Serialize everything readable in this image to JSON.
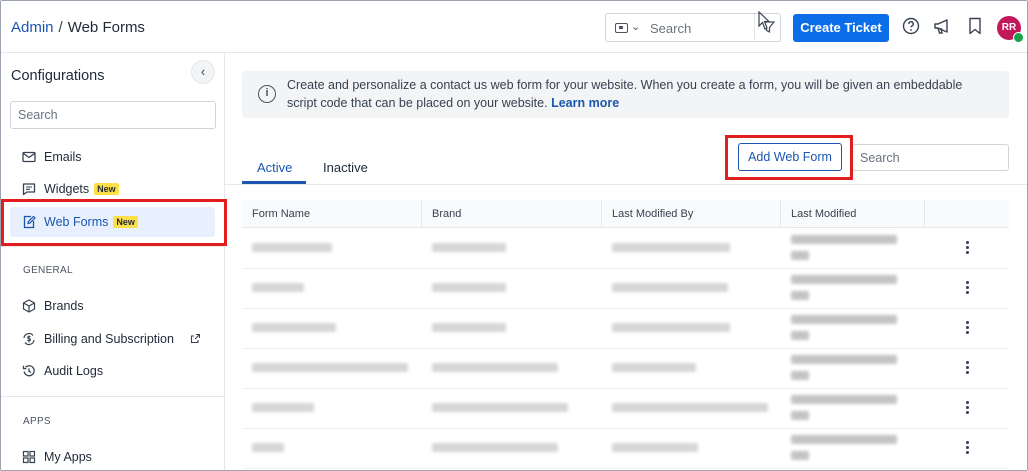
{
  "breadcrumb": {
    "parent": "Admin",
    "separator": "/",
    "current": "Web Forms"
  },
  "header": {
    "search_placeholder": "Search",
    "create_ticket_label": "Create Ticket",
    "avatar_initials": "RR",
    "icons": [
      "ticket-type-icon",
      "filter-icon",
      "help-icon",
      "announcement-icon",
      "bookmark-icon"
    ]
  },
  "sidebar": {
    "title": "Configurations",
    "search_placeholder": "Search",
    "items": [
      {
        "label": "Emails",
        "icon": "mail-icon"
      },
      {
        "label": "Widgets",
        "icon": "chat-icon",
        "badge": "New"
      },
      {
        "label": "Web Forms",
        "icon": "form-edit-icon",
        "badge": "New",
        "active": true
      }
    ],
    "general_label": "GENERAL",
    "general_items": [
      {
        "label": "Brands",
        "icon": "cube-icon"
      },
      {
        "label": "Billing and Subscription",
        "icon": "dollar-cycle-icon",
        "external": true
      },
      {
        "label": "Audit Logs",
        "icon": "history-icon"
      }
    ],
    "apps_label": "APPS",
    "apps_items": [
      {
        "label": "My Apps",
        "icon": "grid-icon"
      }
    ]
  },
  "main": {
    "info_text": "Create and personalize a contact us web form for your website. When you create a form, you will be given an embeddable script code that can be placed on your website.",
    "info_link": "Learn more",
    "tabs": [
      {
        "label": "Active"
      },
      {
        "label": "Inactive"
      }
    ],
    "active_tab": "Active",
    "add_button_label": "Add Web Form",
    "search_placeholder": "Search",
    "table": {
      "columns": [
        "Form Name",
        "Brand",
        "Last Modified By",
        "Last Modified"
      ],
      "rows_note_blurred": 6
    }
  },
  "colors": {
    "primary": "#0b6ee8",
    "link": "#1a56b0",
    "highlight": "#e11d1d",
    "badge": "#fde047"
  }
}
